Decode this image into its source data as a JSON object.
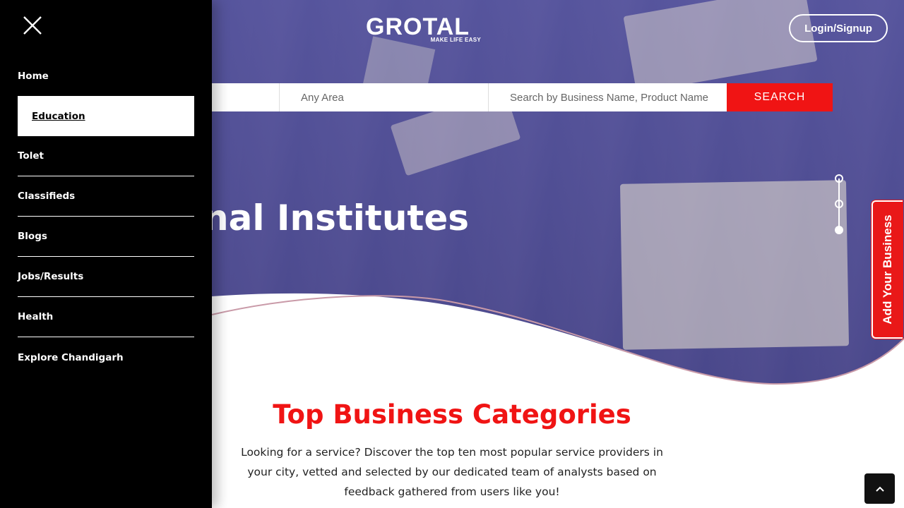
{
  "header": {
    "logo_text": "GROTAL",
    "logo_tagline": "MAKE LIFE EASY",
    "login_label": "Login/Signup"
  },
  "search": {
    "area_placeholder": "Any Area",
    "name_placeholder": "Search by Business Name, Product Name",
    "button_label": "SEARCH"
  },
  "hero": {
    "title_visible": "Educational Institutes",
    "slider_count": 3,
    "active_slide": 3
  },
  "side_tab": {
    "label": "Add Your Business"
  },
  "main": {
    "section_title": "Top Business Categories",
    "section_description": "Looking for a service? Discover the top ten most popular service providers in your city, vetted and selected by our dedicated team of analysts based on feedback gathered from users like you!"
  },
  "sidebar": {
    "close_icon": "close-icon",
    "items": [
      {
        "label": "Home",
        "active": false
      },
      {
        "label": "Education",
        "active": true
      },
      {
        "label": "Tolet",
        "active": false
      },
      {
        "label": "Classifieds",
        "active": false
      },
      {
        "label": "Blogs",
        "active": false
      },
      {
        "label": "Jobs/Results",
        "active": false
      },
      {
        "label": "Health",
        "active": false
      },
      {
        "label": "Explore Chandigarh",
        "active": false
      }
    ]
  },
  "scroll_top": {
    "icon": "chevron-up-icon"
  },
  "colors": {
    "accent": "#f01414",
    "hero_overlay": "#5458b4",
    "sidebar_bg": "#000000"
  }
}
